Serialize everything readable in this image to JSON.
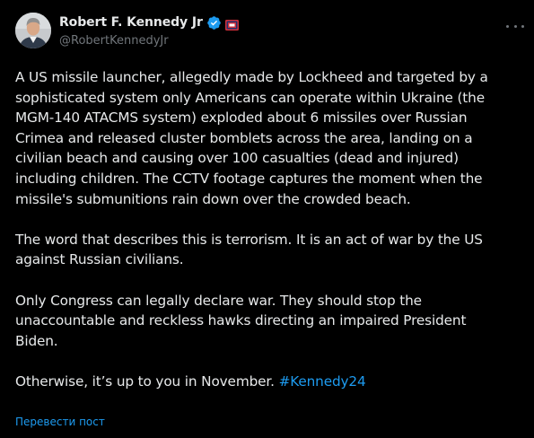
{
  "author": {
    "display_name": "Robert F. Kennedy Jr",
    "handle": "@RobertKennedyJr",
    "verified": true
  },
  "post": {
    "paragraphs": [
      [
        "A US missile launcher, allegedly made by Lockheed and targeted by a",
        "sophisticated system only Americans can operate within Ukraine (the",
        "MGM-140 ATACMS system) exploded about 6 missiles over Russian",
        "Crimea and released cluster bomblets across the area, landing on a",
        "civilian beach and causing over 100 casualties (dead and injured)",
        "including children. The CCTV footage captures the moment when the",
        "missile's submunitions rain down over the crowded beach."
      ],
      [
        "The word that describes this is terrorism. It is an act of war by the US",
        "against Russian civilians."
      ],
      [
        "Only Congress can legally declare war. They should stop the",
        "unaccountable and reckless hawks directing an impaired President",
        "Biden."
      ]
    ],
    "last_line_text": "Otherwise, it’s up to you in November. ",
    "hashtag": "#Kennedy24"
  },
  "translate_label": "Перевести пост",
  "icons": {
    "verified": "verified-badge-icon",
    "flag": "flag-icon",
    "more": "more-options-icon"
  },
  "colors": {
    "background": "#000000",
    "text": "#e7e9ea",
    "secondary_text": "#71767b",
    "link": "#1d9bf0"
  }
}
